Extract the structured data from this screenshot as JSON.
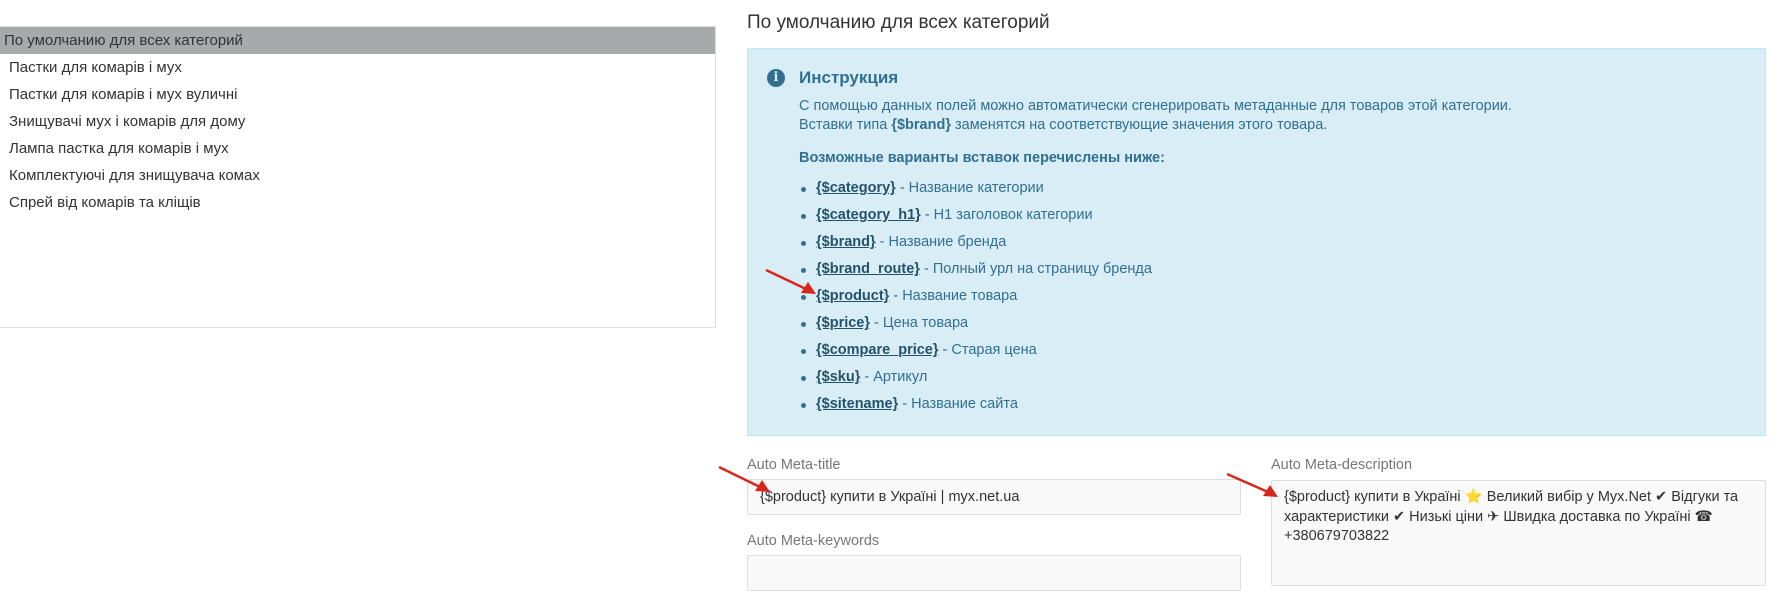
{
  "categories": {
    "items": [
      {
        "label": "По умолчанию для всех категорий",
        "active": true
      },
      {
        "label": "Пастки для комарів і мух",
        "active": false
      },
      {
        "label": "Пастки для комарів і мух вуличні",
        "active": false
      },
      {
        "label": "Знищувачі мух і комарів для дому",
        "active": false
      },
      {
        "label": "Лампа пастка для комарів і мух",
        "active": false
      },
      {
        "label": "Комплектуючі для знищувача комах",
        "active": false
      },
      {
        "label": "Спрей від комарів та кліщів",
        "active": false
      }
    ]
  },
  "main": {
    "title": "По умолчанию для всех категорий",
    "instruction": {
      "title": "Инструкция",
      "line1": "С помощью данных полей можно автоматически сгенерировать метаданные для товаров этой категории.",
      "line2_prefix": "Вставки типа ",
      "line2_token": "{$brand}",
      "line2_suffix": " заменятся на соответствующие значения этого товара.",
      "variants_heading": "Возможные варианты вставок перечислены ниже:",
      "variants": [
        {
          "token": "{$category}",
          "desc": " - Название категории"
        },
        {
          "token": "{$category_h1}",
          "desc": " - H1 заголовок категории"
        },
        {
          "token": "{$brand}",
          "desc": " - Название бренда"
        },
        {
          "token": "{$brand_route}",
          "desc": " - Полный урл на страницу бренда"
        },
        {
          "token": "{$product}",
          "desc": " - Название товара"
        },
        {
          "token": "{$price}",
          "desc": " - Цена товара"
        },
        {
          "token": "{$compare_price}",
          "desc": " - Старая цена"
        },
        {
          "token": "{$sku}",
          "desc": " - Артикул"
        },
        {
          "token": "{$sitename}",
          "desc": " - Название сайта"
        }
      ]
    },
    "form": {
      "meta_title_label": "Auto Meta-title",
      "meta_title_value": "{$product} купити в Україні | myx.net.ua",
      "meta_keywords_label": "Auto Meta-keywords",
      "meta_keywords_value": "",
      "meta_description_label": "Auto Meta-description",
      "meta_description_value": "{$product} купити в Україні ⭐ Великий вибір у Myx.Net ✔ Відгуки та характеристики ✔ Низькі ціни ✈ Швидка доставка по Україні ☎ +380679703822"
    }
  },
  "annotations": {
    "arrow_color": "#d9261c"
  },
  "colors": {
    "info_bg": "#d9edf7",
    "info_text": "#31708f",
    "active_item_bg": "#a7a9ab"
  }
}
